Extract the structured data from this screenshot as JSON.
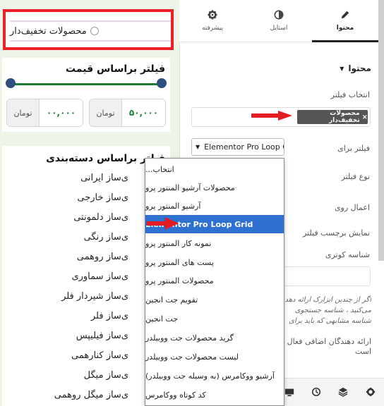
{
  "preview": {
    "sale_label": "محصولات تخفیف‌دار",
    "price_filter": {
      "title": "فیلتر براساس قیمت",
      "min_value": "۵۰,۰۰۰",
      "max_value": "۰۰,۰۰۰",
      "unit": "تومان"
    },
    "category_filter": {
      "title": "فیلتر براساس دسته‌بندی",
      "items": [
        "ی‌ساز ایرانی",
        "ی‌ساز خارجی",
        "ی‌ساز دلمونتی",
        "ی‌ساز رنگی",
        "ی‌ساز روهمی",
        "ی‌ساز سماوری",
        "ی‌ساز شیردار فلر",
        "ی‌ساز فلر",
        "ی‌ساز فیلیپس",
        "ی‌ساز کنارهمی",
        "ی‌ساز میگل",
        "ی‌ساز میگل روهمی"
      ]
    }
  },
  "panel": {
    "tabs": [
      {
        "label": "محتوا",
        "icon": "pencil-icon"
      },
      {
        "label": "استایل",
        "icon": "half-circle-icon"
      },
      {
        "label": "پیشرفته",
        "icon": "gear-icon"
      }
    ],
    "section_title": "محتوا",
    "fields": {
      "select_filter_label": "انتخاب فیلتر",
      "selected_tag": "محصولات تخفیف‌دار",
      "filter_for_label": "فیلتر برای",
      "filter_for_value": "Elementor Pro Loop Grid",
      "filter_type_label": "نوع فیلتر",
      "apply_on_label": "اعمال روی",
      "show_label_label": "نمایش برچسب فیلتر",
      "short_id_label": "شناسه کوتری",
      "help_text": "اگر از چندین ابزارک ارائه دهد می‌کنید ، شناسه جستجوی شناسه مشابهی که باید برای",
      "extra_providers_label": "ارائه دهندگان اضافی فعال است"
    },
    "dropdown_options": [
      "انتخاب...",
      "محصولات آرشیو المنتور پرو",
      "آرشیو المنتور پرو",
      "Elementor Pro Loop Grid",
      "نمونه کار المنتور پرو",
      "پست های المنتور پرو",
      "محصولات المنتور پرو",
      "تقویم جت انجین",
      "جت انجین",
      "گرید محصولات جت ووبیلدر",
      "لیست محصولات جت ووبیلدر",
      "آرشیو ووکامرس (به وسیله جت ووبیلدر)",
      "کد کوتاه ووکامرس"
    ],
    "dropdown_selected_index": 3,
    "bottom_icons": [
      "settings-icon",
      "layers-icon",
      "history-icon",
      "responsive-icon"
    ]
  },
  "colors": {
    "accent_red": "#ef1f27",
    "slider_green": "#1d7b2d",
    "knob_blue": "#2f4e80",
    "selected_blue": "#2f71d0"
  }
}
